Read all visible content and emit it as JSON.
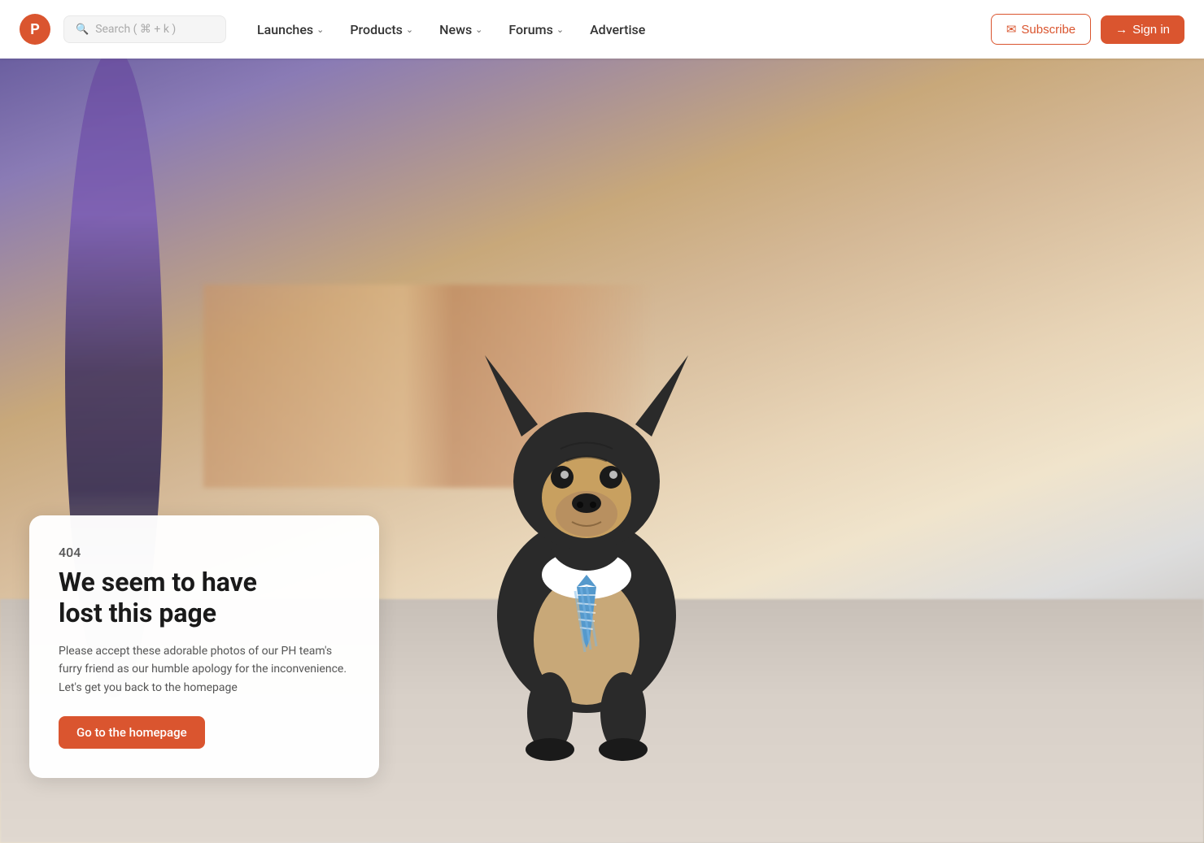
{
  "navbar": {
    "logo_letter": "P",
    "search_placeholder": "Search ( ⌘ + k )",
    "nav_items": [
      {
        "label": "Launches",
        "has_chevron": true
      },
      {
        "label": "Products",
        "has_chevron": true
      },
      {
        "label": "News",
        "has_chevron": true
      },
      {
        "label": "Forums",
        "has_chevron": true
      },
      {
        "label": "Advertise",
        "has_chevron": false
      }
    ],
    "subscribe_label": "Subscribe",
    "signin_label": "Sign in"
  },
  "error_page": {
    "code": "404",
    "title_line1": "We seem to have",
    "title_line2": "lost this page",
    "description": "Please accept these adorable photos of our PH team's furry friend as our humble apology for the inconvenience. Let's get you back to the homepage",
    "cta_label": "Go to the homepage"
  },
  "colors": {
    "brand_orange": "#da552f",
    "nav_bg": "#ffffff",
    "card_bg": "#ffffff"
  }
}
